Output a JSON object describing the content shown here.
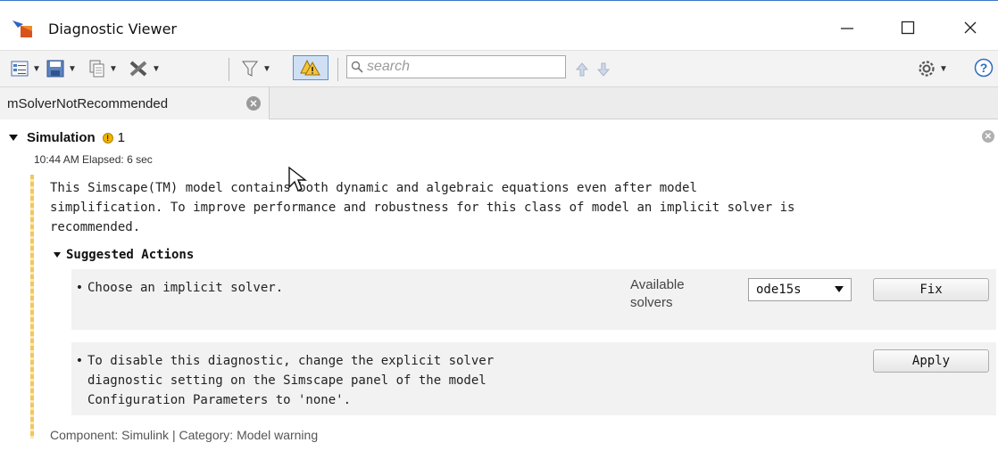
{
  "window": {
    "title": "Diagnostic Viewer",
    "controls": {
      "minimize": "—",
      "maximize": "☐",
      "close": "✕"
    }
  },
  "toolbar": {
    "search": {
      "placeholder": "search",
      "value": ""
    },
    "icons": [
      "list-view-icon",
      "save-icon",
      "copy-icon",
      "clear-icon",
      "filter-icon",
      "warning-toggle-icon",
      "up-arrow-icon",
      "down-arrow-icon",
      "settings-icon",
      "help-icon"
    ],
    "help_label": "?"
  },
  "tabs": [
    {
      "label": "mSolverNotRecommended",
      "close": "✕"
    }
  ],
  "diagnostic": {
    "title": "Simulation",
    "warning_count": "1",
    "warning_symbol": "!",
    "elapsed": "10:44 AM  Elapsed: 6 sec",
    "dismiss": "✕",
    "message_line1": "This Simscape(TM) model contains both dynamic and algebraic equations even after model",
    "message_line2": "simplification. To improve performance and robustness for this class of model an implicit solver is",
    "message_line3": "recommended.",
    "suggested_actions_title": "Suggested Actions",
    "actions": [
      {
        "bullet": "•",
        "text_line1": "Choose an implicit solver.",
        "solvers_label_line1": "Available",
        "solvers_label_line2": "solvers",
        "solver_selected": "ode15s",
        "button": "Fix"
      },
      {
        "bullet": "•",
        "text_line1": "To disable this diagnostic, change the explicit solver",
        "text_line2": "diagnostic setting on the Simscape panel of the model",
        "text_line3": "Configuration Parameters to 'none'.",
        "button": "Apply"
      }
    ],
    "footer": "Component: Simulink | Category: Model warning"
  },
  "colors": {
    "warning_yellow": "#f0b400",
    "accent_blue": "#5a8fd0",
    "stripe_yellow": "#f3c65a"
  }
}
